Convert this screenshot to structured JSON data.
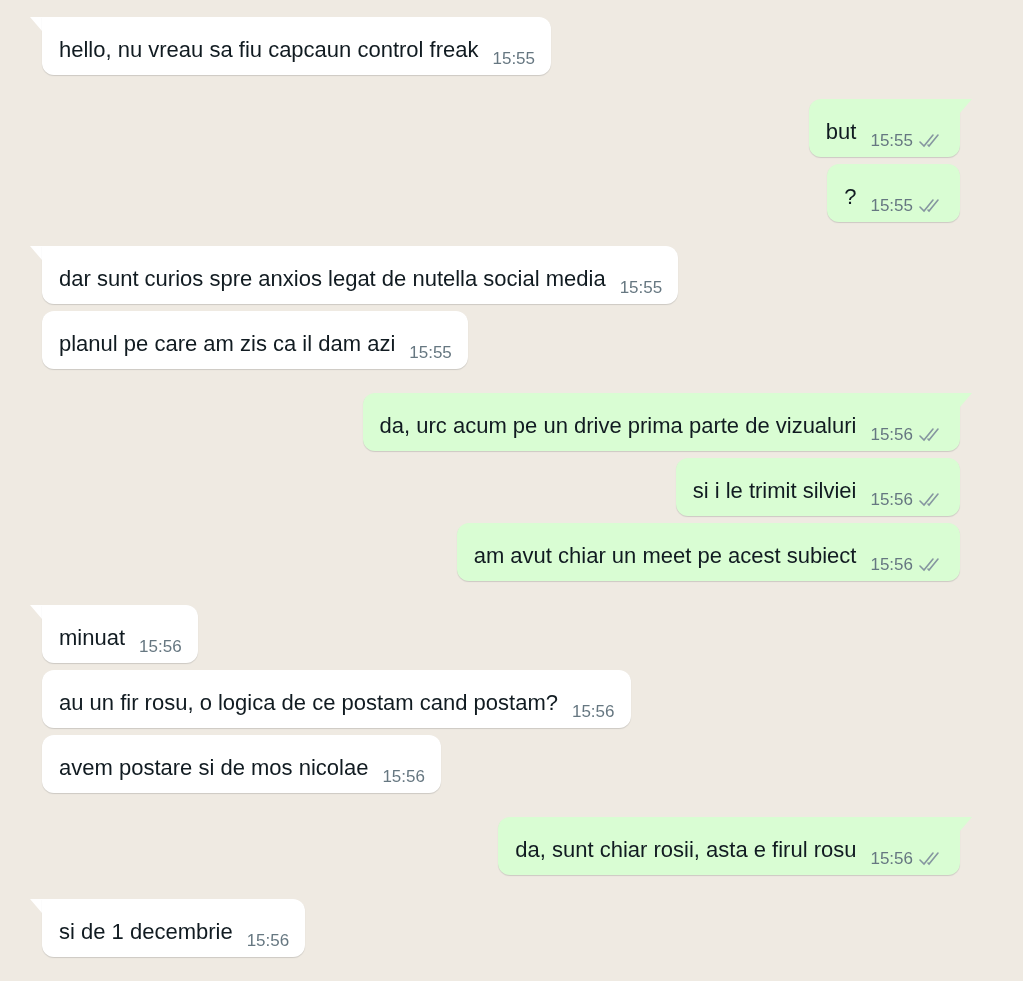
{
  "messages": [
    {
      "kind": "incoming",
      "tail": true,
      "text": "hello, nu vreau sa fiu capcaun control freak",
      "time": "15:55"
    },
    {
      "kind": "outgoing",
      "tail": true,
      "text": "but",
      "time": "15:55",
      "delivered": true
    },
    {
      "kind": "outgoing",
      "tail": false,
      "text": "?",
      "time": "15:55",
      "delivered": true
    },
    {
      "kind": "incoming",
      "tail": true,
      "text": "dar sunt curios spre anxios legat de nutella social media",
      "time": "15:55"
    },
    {
      "kind": "incoming",
      "tail": false,
      "text": "planul pe care am zis ca il dam azi",
      "time": "15:55"
    },
    {
      "kind": "outgoing",
      "tail": true,
      "text": "da, urc acum pe un drive prima parte de vizualuri",
      "time": "15:56",
      "delivered": true
    },
    {
      "kind": "outgoing",
      "tail": false,
      "text": "si i le trimit silviei",
      "time": "15:56",
      "delivered": true
    },
    {
      "kind": "outgoing",
      "tail": false,
      "text": "am avut chiar un meet pe acest subiect",
      "time": "15:56",
      "delivered": true
    },
    {
      "kind": "incoming",
      "tail": true,
      "text": "minuat",
      "time": "15:56"
    },
    {
      "kind": "incoming",
      "tail": false,
      "text": "au un fir rosu, o logica de ce postam cand postam?",
      "time": "15:56"
    },
    {
      "kind": "incoming",
      "tail": false,
      "text": "avem postare si de mos nicolae",
      "time": "15:56"
    },
    {
      "kind": "outgoing",
      "tail": true,
      "text": "da, sunt chiar rosii, asta e firul rosu",
      "time": "15:56",
      "delivered": true
    },
    {
      "kind": "incoming",
      "tail": true,
      "text": "si de 1 decembrie",
      "time": "15:56"
    }
  ]
}
